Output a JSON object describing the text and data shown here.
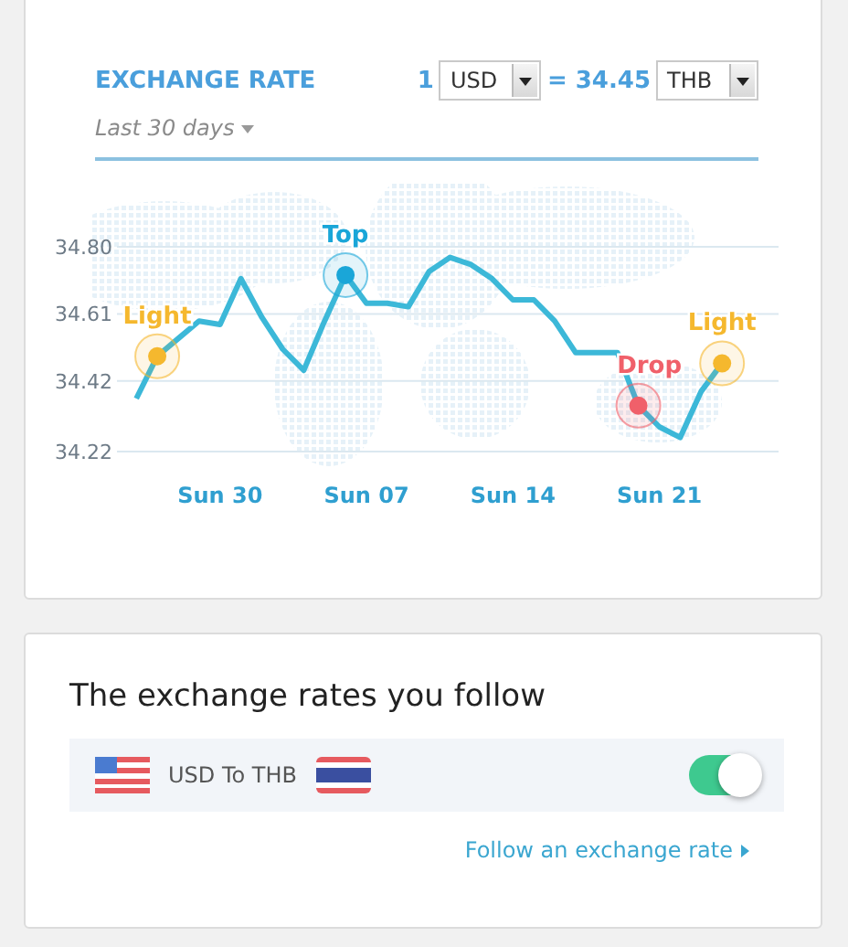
{
  "exchange_rate": {
    "title": "EXCHANGE RATE",
    "range": {
      "label": "Last 30 days"
    },
    "converter": {
      "amount": "1",
      "from": "USD",
      "rate": "= 34.45",
      "to": "THB"
    },
    "chart_data": {
      "type": "line",
      "grid": true,
      "categories": [
        null,
        null,
        null,
        null,
        "Sun 30",
        null,
        null,
        null,
        null,
        null,
        null,
        "Sun 07",
        null,
        null,
        null,
        null,
        null,
        null,
        "Sun 14",
        null,
        null,
        null,
        null,
        null,
        null,
        "Sun 21",
        null,
        null,
        null
      ],
      "series": [
        {
          "color": "#3cb8d8",
          "values": [
            34.37,
            34.49,
            34.54,
            34.59,
            34.58,
            34.71,
            34.6,
            34.51,
            34.45,
            34.59,
            34.72,
            34.64,
            34.64,
            34.63,
            34.73,
            34.77,
            34.75,
            34.71,
            34.65,
            34.65,
            34.59,
            34.5,
            34.5,
            34.5,
            34.35,
            34.29,
            34.26,
            34.39,
            34.47
          ]
        }
      ],
      "ylim": [
        34.22,
        34.8
      ],
      "yticks": [
        {
          "value": 34.22,
          "label": "34.22"
        },
        {
          "value": 34.42,
          "label": "34.42"
        },
        {
          "value": 34.61,
          "label": "34.61"
        },
        {
          "value": 34.8,
          "label": "34.80"
        }
      ],
      "annotations": [
        {
          "y": 34.49,
          "text": "Light"
        },
        {
          "y": 34.72,
          "text": "Top"
        },
        {
          "y": 34.35,
          "text": "Drop"
        },
        {
          "y": 34.47,
          "text": "Light"
        }
      ]
    },
    "annotation_styles": [
      {
        "color": "#f5b82e"
      },
      {
        "color": "#1aa6d8"
      },
      {
        "color": "#f0606a"
      },
      {
        "color": "#f5b82e"
      }
    ]
  },
  "following": {
    "title": "The exchange rates you follow",
    "rows": [
      {
        "pair": "USD To THB",
        "on": true
      }
    ],
    "link": "Follow an exchange rate"
  }
}
